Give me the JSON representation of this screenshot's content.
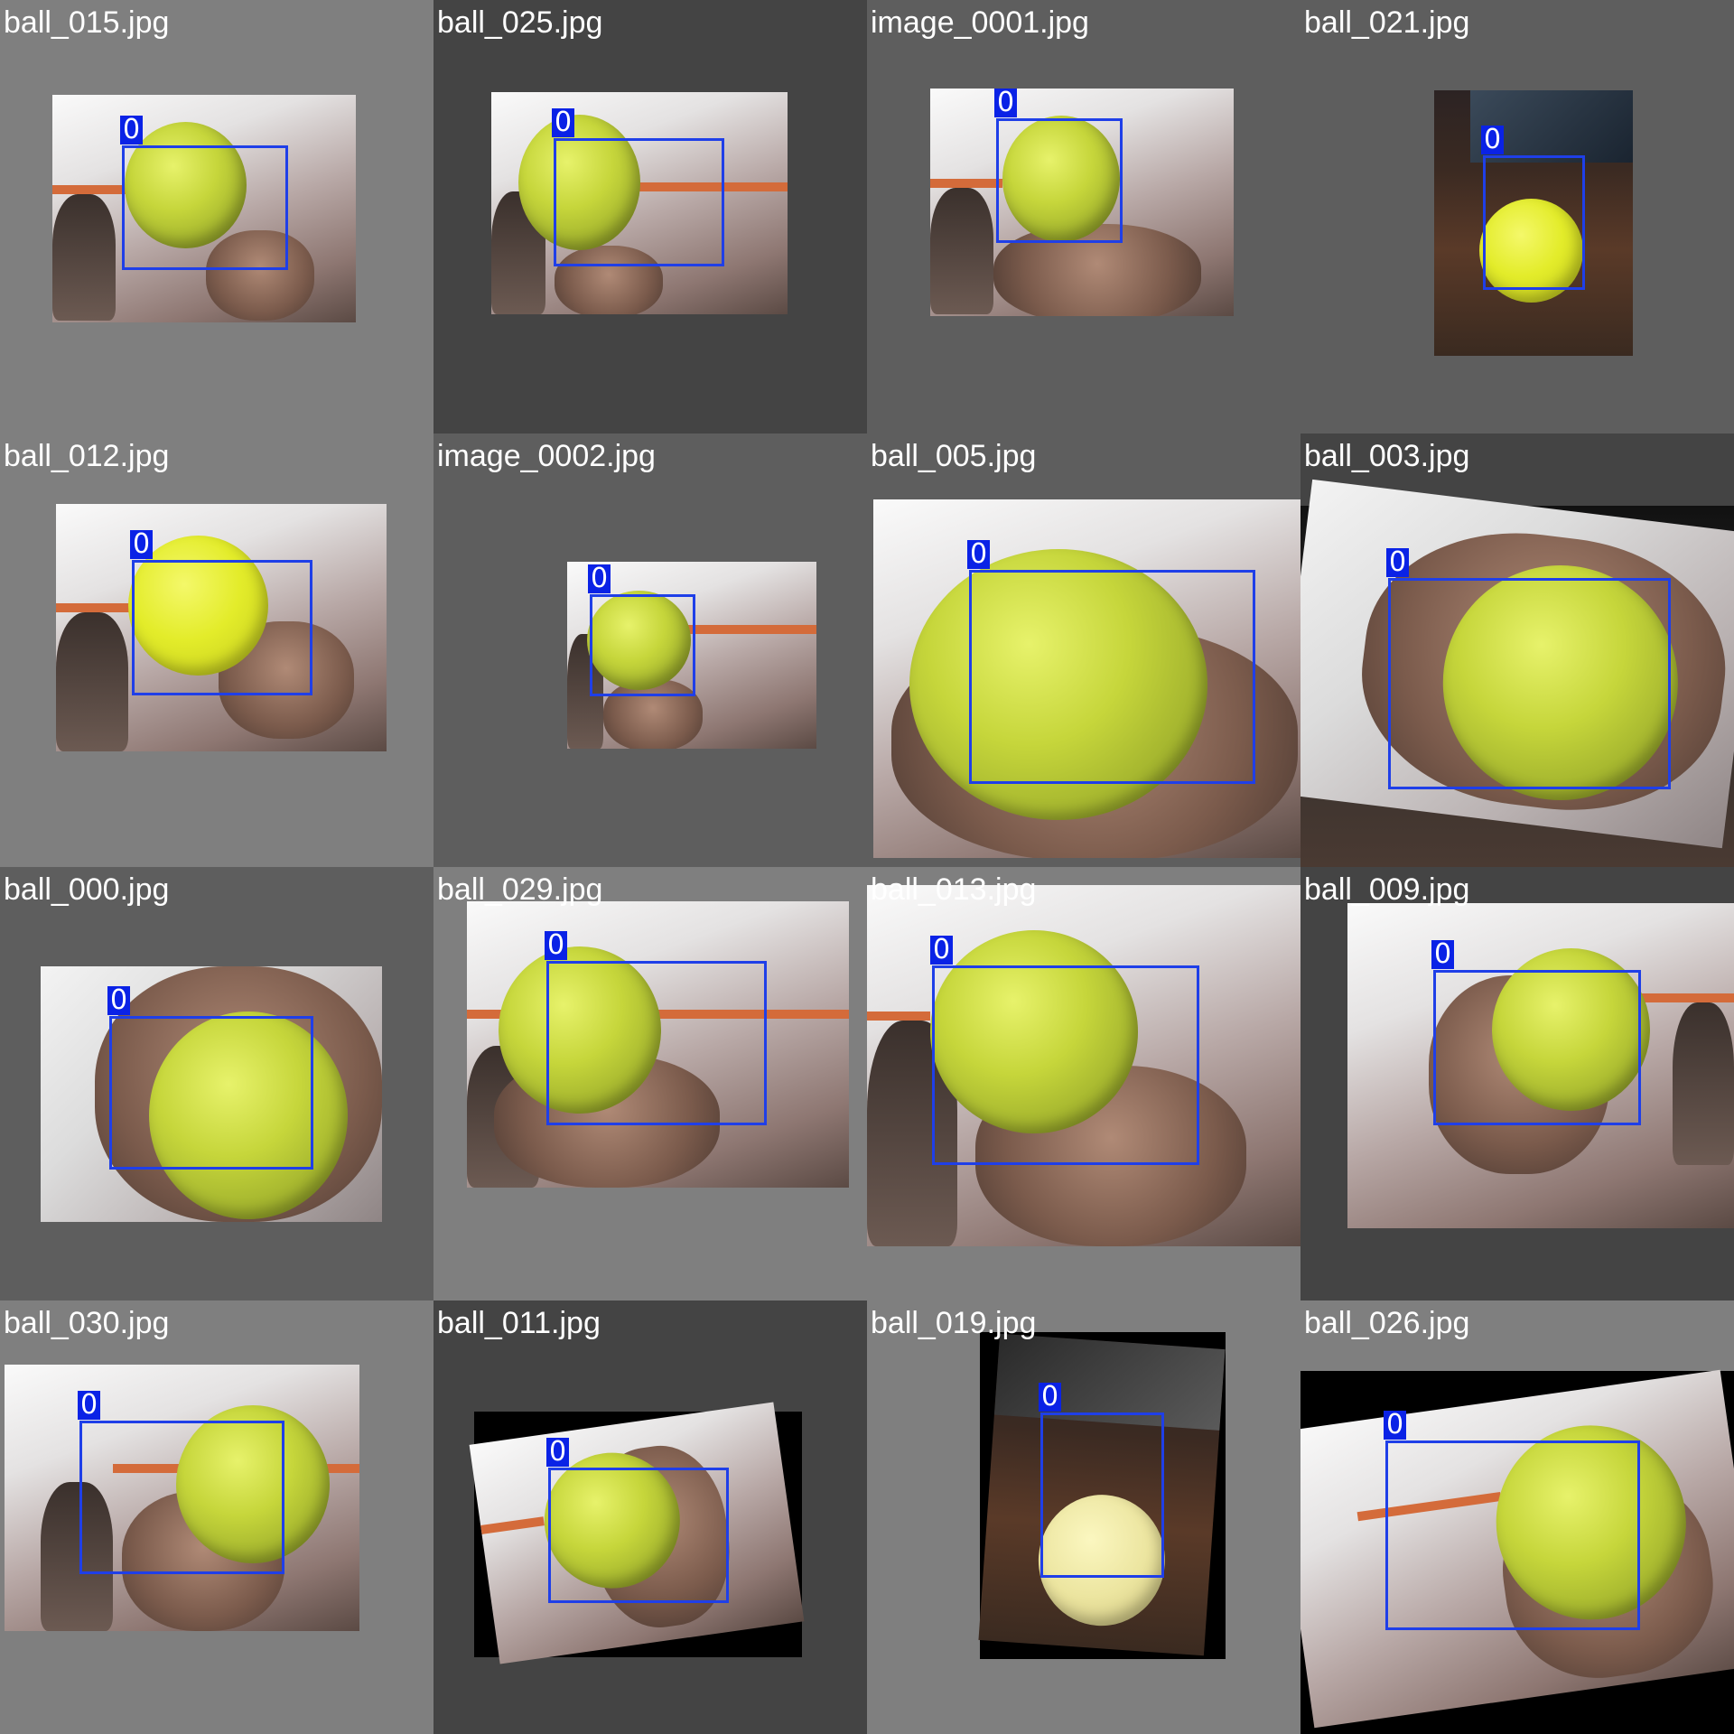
{
  "mosaic": {
    "title": "",
    "tiles": [
      {
        "filename": "ball_015.jpg",
        "label": "0"
      },
      {
        "filename": "ball_025.jpg",
        "label": "0"
      },
      {
        "filename": "image_0001.jpg",
        "label": "0"
      },
      {
        "filename": "ball_021.jpg",
        "label": "0"
      },
      {
        "filename": "ball_012.jpg",
        "label": "0"
      },
      {
        "filename": "image_0002.jpg",
        "label": "0"
      },
      {
        "filename": "ball_005.jpg",
        "label": "0"
      },
      {
        "filename": "ball_003.jpg",
        "label": "0"
      },
      {
        "filename": "ball_000.jpg",
        "label": "0"
      },
      {
        "filename": "ball_029.jpg",
        "label": "0"
      },
      {
        "filename": "ball_013.jpg",
        "label": "0"
      },
      {
        "filename": "ball_009.jpg",
        "label": "0"
      },
      {
        "filename": "ball_030.jpg",
        "label": "0"
      },
      {
        "filename": "ball_011.jpg",
        "label": "0"
      },
      {
        "filename": "ball_019.jpg",
        "label": "0"
      },
      {
        "filename": "ball_026.jpg",
        "label": "0"
      }
    ]
  },
  "colors": {
    "bbox": "#1f3fe8",
    "label_bg": "#0a22e6",
    "caption": "#ffffff"
  },
  "icons": {
    "tile_photo": "photo-thumbnail",
    "object": "tennis-ball"
  }
}
